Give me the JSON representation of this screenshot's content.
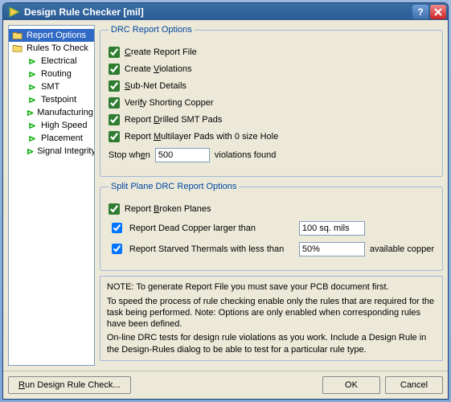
{
  "window": {
    "title": "Design Rule Checker [mil]"
  },
  "tree": {
    "items": [
      {
        "label": "Report Options",
        "kind": "folder",
        "indent": 0,
        "selected": true
      },
      {
        "label": "Rules To Check",
        "kind": "folder",
        "indent": 0
      },
      {
        "label": "Electrical",
        "kind": "rule",
        "indent": 1
      },
      {
        "label": "Routing",
        "kind": "rule",
        "indent": 1
      },
      {
        "label": "SMT",
        "kind": "rule",
        "indent": 1
      },
      {
        "label": "Testpoint",
        "kind": "rule",
        "indent": 1
      },
      {
        "label": "Manufacturing",
        "kind": "rule",
        "indent": 1
      },
      {
        "label": "High Speed",
        "kind": "rule",
        "indent": 1
      },
      {
        "label": "Placement",
        "kind": "rule",
        "indent": 1
      },
      {
        "label": "Signal Integrity",
        "kind": "rule",
        "indent": 1
      }
    ]
  },
  "group1": {
    "legend": "DRC Report Options",
    "opt1": "Create Report File",
    "opt2": "Create Violations",
    "opt3": "Sub-Net Details",
    "opt4": "Verify Shorting Copper",
    "opt5": "Report Drilled SMT Pads",
    "opt6": "Report Multilayer Pads with 0 size Hole",
    "stop_label_pre": "Stop when",
    "stop_value": "500",
    "stop_label_post": "violations found"
  },
  "group2": {
    "legend": "Split Plane DRC Report Options",
    "opt1": "Report Broken Planes",
    "opt2": "Report Dead Copper larger than",
    "opt2_value": "100 sq. mils",
    "opt3": "Report Starved Thermals with less than",
    "opt3_value": "50%",
    "opt3_suffix": "available copper"
  },
  "note": {
    "l1": "NOTE: To generate Report File you must save your PCB document first.",
    "l2": "To speed the process of rule checking enable only the rules that are required for the task being performed.  Note: Options are only enabled when corresponding rules have been defined.",
    "l3": "On-line DRC tests for design rule violations as you work. Include a Design Rule in the Design-Rules dialog to be able to test for a particular rule  type."
  },
  "buttons": {
    "run": "Run Design Rule Check...",
    "ok": "OK",
    "cancel": "Cancel"
  }
}
